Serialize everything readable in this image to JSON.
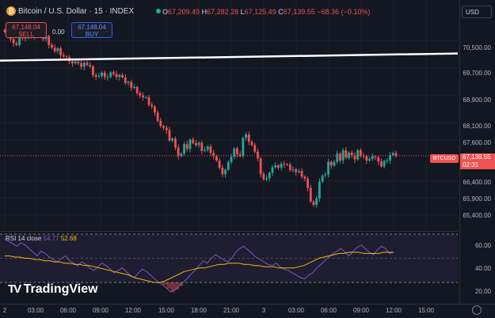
{
  "header": {
    "title": "Bitcoin / U.S. Dollar · 15 · INDEX",
    "open_label": "O",
    "open": "67,209.49",
    "high_label": "H",
    "high": "67,282.28",
    "low_label": "L",
    "low": "67,125.49",
    "close_label": "C",
    "close": "67,139.55",
    "change": "−68.36 (−0.10%)"
  },
  "trade": {
    "sell_price": "67,148.04",
    "sell_label": "SELL",
    "buy_price": "67,148.04",
    "buy_label": "BUY",
    "spread": "0.00"
  },
  "currency": "USD",
  "price_axis": [
    "70,500.00",
    "69,700.00",
    "68,900.00",
    "68,100.00",
    "67,600.00",
    "66,400.00",
    "65,900.00",
    "65,400.00"
  ],
  "price_tag": {
    "symbol": "BTCUSD",
    "price": "67,139.55",
    "countdown": "02:31"
  },
  "rsi": {
    "label": "RSI 14 close",
    "value1": "54.77",
    "value2": "52.68",
    "ticks": [
      "60.00",
      "40.00",
      "20.00"
    ]
  },
  "time_axis": [
    "2",
    "03:00",
    "06:00",
    "09:00",
    "12:00",
    "15:00",
    "18:00",
    "21:00",
    "3",
    "03:00",
    "06:00",
    "09:00",
    "12:00",
    "15:00"
  ],
  "logo_text": "TradingView",
  "colors": {
    "up": "#26a69a",
    "down": "#ef5350",
    "rsi_line": "#7e57c2",
    "rsi_ma": "#f0b90b",
    "trendline": "#ffffff",
    "background": "#131722"
  },
  "icons": [
    "bitcoin-icon",
    "tradingview-logo-icon",
    "settings-icon"
  ],
  "chart_data": {
    "type": "candlestick",
    "candles_close_approx": [
      70760,
      70800,
      70550,
      70430,
      70380,
      70600,
      70590,
      70580,
      70670,
      70620,
      70760,
      70680,
      70620,
      70550,
      70640,
      70380,
      70300,
      70200,
      70280,
      70080,
      70040,
      70020,
      69900,
      69840,
      69890,
      69850,
      69740,
      69860,
      69790,
      69750,
      69500,
      69450,
      69470,
      69570,
      69440,
      69440,
      69580,
      69530,
      69440,
      69500,
      69430,
      69270,
      69300,
      69130,
      69150,
      68970,
      68900,
      68850,
      68850,
      68630,
      68580,
      68400,
      68160,
      68010,
      67960,
      67890,
      67580,
      67640,
      67380,
      67130,
      67200,
      67480,
      67340,
      67610,
      67510,
      67450,
      67520,
      67280,
      67310,
      67410,
      67220,
      67130,
      67000,
      66790,
      66600,
      66730,
      66950,
      67110,
      67350,
      67180,
      67130,
      67660,
      67760,
      67550,
      67450,
      67260,
      67060,
      66610,
      66450,
      66480,
      66640,
      66800,
      66860,
      66790,
      66900,
      66890,
      66880,
      66730,
      66740,
      66660,
      66690,
      66530,
      66470,
      66200,
      65800,
      65700,
      65890,
      66380,
      66560,
      66590,
      66960,
      66850,
      66960,
      67200,
      67000,
      67300,
      67080,
      67230,
      67150,
      67030,
      67300,
      67140,
      67130,
      67000,
      67040,
      67120,
      67090,
      66970,
      66830,
      66990,
      67000,
      67160,
      67220,
      67140
    ],
    "trendline": {
      "start_price": 69920,
      "end_price": 70130
    },
    "rsi_values_approx": [
      66,
      64,
      62,
      60,
      63,
      61,
      58,
      55,
      52,
      56,
      54,
      51,
      49,
      47,
      50,
      52,
      48,
      46,
      44,
      47,
      45,
      42,
      40,
      43,
      46,
      44,
      41,
      38,
      40,
      42,
      39,
      36,
      34,
      38,
      41,
      39,
      36,
      33,
      30,
      28,
      25,
      22,
      24,
      27,
      30,
      33,
      37,
      40,
      44,
      48,
      46,
      50,
      53,
      51,
      49,
      47,
      50,
      55,
      58,
      60,
      57,
      54,
      51,
      49,
      47,
      45,
      44,
      46,
      43,
      41,
      40,
      38,
      36,
      34,
      33,
      36,
      38,
      42,
      45,
      48,
      51,
      54,
      56,
      58,
      55,
      52,
      56,
      59,
      61,
      58,
      55,
      53,
      57,
      60,
      58,
      54,
      55
    ],
    "rsi_ma_approx": [
      52,
      52,
      51,
      51,
      50,
      50,
      49,
      49,
      48,
      48,
      47,
      47,
      46,
      46,
      45,
      45,
      44,
      44,
      43,
      42,
      41,
      40,
      39,
      38,
      37,
      36,
      34,
      33,
      32,
      31,
      30,
      30,
      31,
      33,
      35,
      37,
      39,
      40,
      41,
      42,
      42,
      43,
      44,
      45,
      45,
      46,
      46,
      46,
      45,
      45,
      44,
      44,
      43,
      43,
      43,
      42,
      42,
      42,
      42,
      43,
      44,
      46,
      48,
      50,
      51,
      52,
      53,
      54,
      54,
      55,
      55,
      55,
      54,
      54,
      54,
      54,
      55,
      55,
      55
    ],
    "price_range": [
      65100,
      71000
    ],
    "rsi_range": [
      15,
      70
    ]
  }
}
